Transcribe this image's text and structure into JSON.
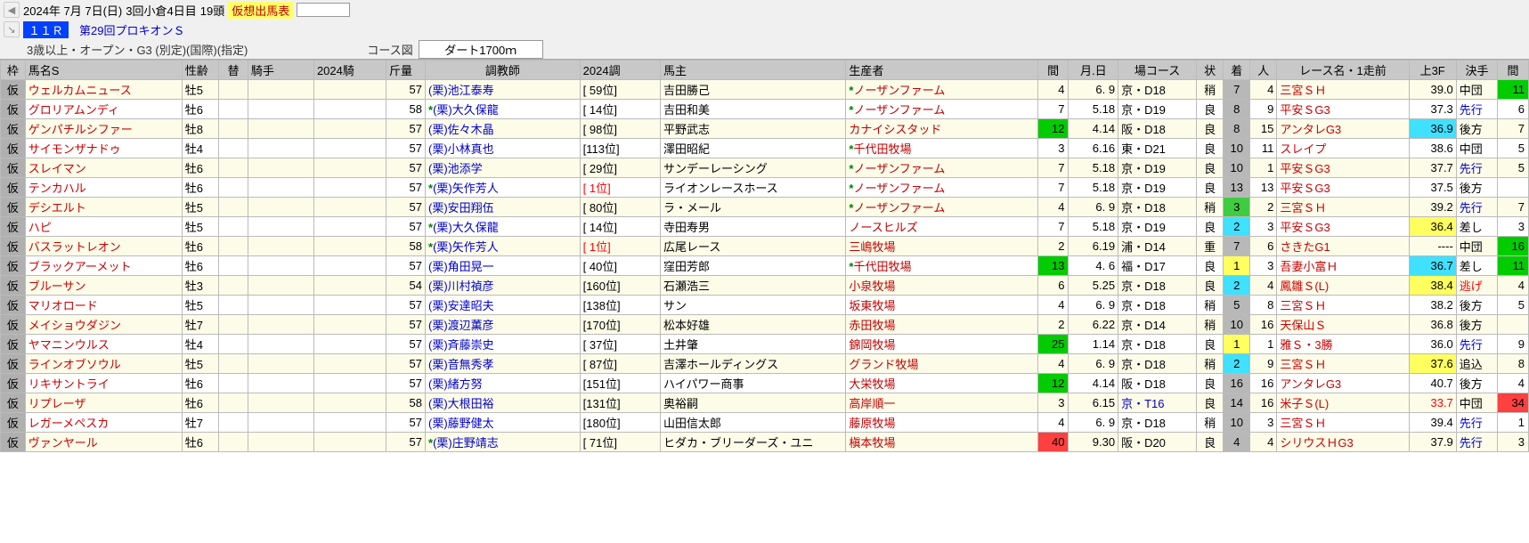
{
  "header": {
    "date": "2024年 7月 7日(日)",
    "meeting": "3回小倉4日目",
    "heads": "19頭",
    "virtual_label": "仮想出馬表",
    "race_number": "１１Ｒ",
    "race_name": "第29回プロキオンＳ",
    "race_conditions": "3歳以上・オープン・G3 (別定)(国際)(指定)",
    "course_label": "コース図",
    "course": "ダート1700ｍ"
  },
  "columns": {
    "frame": "枠",
    "name": "馬名S",
    "sex": "性齢",
    "change": "替",
    "jockey": "騎手",
    "jride": "2024騎",
    "wt": "斤量",
    "trainer": "調教師",
    "trank": "2024調",
    "owner": "馬主",
    "breeder": "生産者",
    "gap": "間",
    "md": "月.日",
    "track": "場コース",
    "cond": "状",
    "pos": "着",
    "heads": "人",
    "lrace": "レース名・1走前",
    "f3": "上3F",
    "style": "決手",
    "gap2": "間"
  },
  "rows": [
    {
      "kari": "仮",
      "name": "ウェルカムニュース",
      "sex": "牡5",
      "wt": "57",
      "trStar": "",
      "trainer": "(栗)池江泰寿",
      "trank": "[ 59位]",
      "owner": "吉田勝己",
      "brStar": "*",
      "breeder": "ノーザンファーム",
      "gap": "4",
      "md": "6. 9",
      "crs": "京・D18",
      "cond": "稍",
      "pos": "7",
      "posCls": "pos-gray",
      "heads": "4",
      "lrace": "三宮ＳＨ",
      "f3": "39.0",
      "f3Cls": "f3-norm",
      "style": "中団",
      "styleCls": "",
      "gap2": "11",
      "gap2Cls": "gap-green"
    },
    {
      "kari": "仮",
      "name": "グロリアムンディ",
      "sex": "牡6",
      "wt": "58",
      "trStar": "*",
      "trainer": "(栗)大久保龍",
      "trank": "[ 14位]",
      "owner": "吉田和美",
      "brStar": "*",
      "breeder": "ノーザンファーム",
      "gap": "7",
      "md": "5.18",
      "crs": "京・D19",
      "cond": "良",
      "pos": "8",
      "posCls": "pos-gray",
      "heads": "9",
      "lrace": "平安ＳG3",
      "f3": "37.3",
      "f3Cls": "f3-norm",
      "style": "先行",
      "styleCls": "style-blue",
      "gap2": "6",
      "gap2Cls": "gap-norm"
    },
    {
      "kari": "仮",
      "name": "ゲンパチルシファー",
      "sex": "牡8",
      "wt": "57",
      "trStar": "",
      "trainer": "(栗)佐々木晶",
      "trank": "[ 98位]",
      "owner": "平野武志",
      "brStar": "",
      "breeder": "カナイシスタッド",
      "gap": "12",
      "gapCls": "gap-green",
      "md": "4.14",
      "crs": "阪・D18",
      "cond": "良",
      "pos": "8",
      "posCls": "pos-gray",
      "heads": "15",
      "lrace": "アンタレG3",
      "f3": "36.9",
      "f3Cls": "f3-cyan",
      "style": "後方",
      "styleCls": "",
      "gap2": "7",
      "gap2Cls": "gap-norm"
    },
    {
      "kari": "仮",
      "name": "サイモンザナドゥ",
      "sex": "牡4",
      "wt": "57",
      "trStar": "",
      "trainer": "(栗)小林真也",
      "trank": "[113位]",
      "owner": "澤田昭紀",
      "brStar": "*",
      "breeder": "千代田牧場",
      "gap": "3",
      "md": "6.16",
      "crs": "東・D21",
      "cond": "良",
      "pos": "10",
      "posCls": "pos-gray",
      "heads": "11",
      "lrace": "スレイプ",
      "f3": "38.6",
      "f3Cls": "f3-norm",
      "style": "中団",
      "styleCls": "",
      "gap2": "5",
      "gap2Cls": "gap-norm"
    },
    {
      "kari": "仮",
      "name": "スレイマン",
      "sex": "牡6",
      "wt": "57",
      "trStar": "",
      "trainer": "(栗)池添学",
      "trank": "[ 29位]",
      "owner": "サンデーレーシング",
      "brStar": "*",
      "breeder": "ノーザンファーム",
      "gap": "7",
      "md": "5.18",
      "crs": "京・D19",
      "cond": "良",
      "pos": "10",
      "posCls": "pos-gray",
      "heads": "1",
      "lrace": "平安ＳG3",
      "f3": "37.7",
      "f3Cls": "f3-norm",
      "style": "先行",
      "styleCls": "style-blue",
      "gap2": "5",
      "gap2Cls": "gap-norm"
    },
    {
      "kari": "仮",
      "name": "テンカハル",
      "sex": "牡6",
      "wt": "57",
      "trStar": "*",
      "trainer": "(栗)矢作芳人",
      "trank": "[   1位]",
      "trankRed": true,
      "owner": "ライオンレースホース",
      "brStar": "*",
      "breeder": "ノーザンファーム",
      "gap": "7",
      "md": "5.18",
      "crs": "京・D19",
      "cond": "良",
      "pos": "13",
      "posCls": "pos-gray",
      "heads": "13",
      "lrace": "平安ＳG3",
      "f3": "37.5",
      "f3Cls": "f3-norm",
      "style": "後方",
      "styleCls": "",
      "gap2": "",
      "gap2Cls": "gap-norm"
    },
    {
      "kari": "仮",
      "name": "デシエルト",
      "sex": "牡5",
      "wt": "57",
      "trStar": "",
      "trainer": "(栗)安田翔伍",
      "trank": "[ 80位]",
      "owner": "ラ・メール",
      "brStar": "*",
      "breeder": "ノーザンファーム",
      "gap": "4",
      "md": "6. 9",
      "crs": "京・D18",
      "cond": "稍",
      "pos": "3",
      "posCls": "pos-green",
      "heads": "2",
      "lrace": "三宮ＳＨ",
      "f3": "39.2",
      "f3Cls": "f3-norm",
      "style": "先行",
      "styleCls": "style-blue",
      "gap2": "7",
      "gap2Cls": "gap-norm"
    },
    {
      "kari": "仮",
      "name": "ハピ",
      "sex": "牡5",
      "wt": "57",
      "trStar": "*",
      "trainer": "(栗)大久保龍",
      "trank": "[ 14位]",
      "owner": "寺田寿男",
      "brStar": "",
      "breeder": "ノースヒルズ",
      "gap": "7",
      "md": "5.18",
      "crs": "京・D19",
      "cond": "良",
      "pos": "2",
      "posCls": "pos-cyan",
      "heads": "3",
      "lrace": "平安ＳG3",
      "f3": "36.4",
      "f3Cls": "f3-yellow",
      "style": "差し",
      "styleCls": "",
      "gap2": "3",
      "gap2Cls": "gap-norm"
    },
    {
      "kari": "仮",
      "name": "バスラットレオン",
      "sex": "牡6",
      "wt": "58",
      "trStar": "*",
      "trainer": "(栗)矢作芳人",
      "trank": "[   1位]",
      "trankRed": true,
      "owner": "広尾レース",
      "brStar": "",
      "breeder": "三嶋牧場",
      "gap": "2",
      "md": "6.19",
      "crs": "浦・D14",
      "cond": "重",
      "pos": "7",
      "posCls": "pos-gray",
      "heads": "6",
      "lrace": "さきたG1",
      "f3": "----",
      "f3Cls": "f3-norm",
      "style": "中団",
      "styleCls": "",
      "gap2": "16",
      "gap2Cls": "gap-green"
    },
    {
      "kari": "仮",
      "name": "ブラックアーメット",
      "sex": "牡6",
      "wt": "57",
      "trStar": "",
      "trainer": "(栗)角田晃一",
      "trank": "[ 40位]",
      "owner": "窪田芳郎",
      "brStar": "*",
      "breeder": "千代田牧場",
      "gap": "13",
      "gapCls": "gap-green",
      "md": "4. 6",
      "crs": "福・D17",
      "cond": "良",
      "pos": "1",
      "posCls": "pos-yellow",
      "heads": "3",
      "lrace": "吾妻小富Ｈ",
      "f3": "36.7",
      "f3Cls": "f3-cyan",
      "style": "差し",
      "styleCls": "",
      "gap2": "11",
      "gap2Cls": "gap-green"
    },
    {
      "kari": "仮",
      "name": "ブルーサン",
      "sex": "牡3",
      "wt": "54",
      "trStar": "",
      "trainer": "(栗)川村禎彦",
      "trank": "[160位]",
      "owner": "石瀬浩三",
      "brStar": "",
      "breeder": "小泉牧場",
      "gap": "6",
      "md": "5.25",
      "crs": "京・D18",
      "cond": "良",
      "pos": "2",
      "posCls": "pos-cyan",
      "heads": "4",
      "lrace": "鳳雛Ｓ(L)",
      "f3": "38.4",
      "f3Cls": "f3-yellow",
      "style": "逃げ",
      "styleCls": "style-red",
      "gap2": "4",
      "gap2Cls": "gap-norm"
    },
    {
      "kari": "仮",
      "name": "マリオロード",
      "sex": "牡5",
      "wt": "57",
      "trStar": "",
      "trainer": "(栗)安達昭夫",
      "trank": "[138位]",
      "owner": "サン",
      "brStar": "",
      "breeder": "坂東牧場",
      "gap": "4",
      "md": "6. 9",
      "crs": "京・D18",
      "cond": "稍",
      "pos": "5",
      "posCls": "pos-gray",
      "heads": "8",
      "lrace": "三宮ＳＨ",
      "f3": "38.2",
      "f3Cls": "f3-norm",
      "style": "後方",
      "styleCls": "",
      "gap2": "5",
      "gap2Cls": "gap-norm"
    },
    {
      "kari": "仮",
      "name": "メイショウダジン",
      "sex": "牡7",
      "wt": "57",
      "trStar": "",
      "trainer": "(栗)渡辺薫彦",
      "trank": "[170位]",
      "owner": "松本好雄",
      "brStar": "",
      "breeder": "赤田牧場",
      "gap": "2",
      "md": "6.22",
      "crs": "京・D14",
      "cond": "稍",
      "pos": "10",
      "posCls": "pos-gray",
      "heads": "16",
      "lrace": "天保山Ｓ",
      "f3": "36.8",
      "f3Cls": "f3-norm",
      "style": "後方",
      "styleCls": "",
      "gap2": "",
      "gap2Cls": "gap-norm"
    },
    {
      "kari": "仮",
      "name": "ヤマニンウルス",
      "sex": "牡4",
      "wt": "57",
      "trStar": "",
      "trainer": "(栗)斉藤崇史",
      "trank": "[ 37位]",
      "owner": "土井肇",
      "brStar": "",
      "breeder": "錦岡牧場",
      "gap": "25",
      "gapCls": "gap-green",
      "md": "1.14",
      "crs": "京・D18",
      "cond": "良",
      "pos": "1",
      "posCls": "pos-yellow",
      "heads": "1",
      "lrace": "雅Ｓ・3勝",
      "f3": "36.0",
      "f3Cls": "f3-norm",
      "style": "先行",
      "styleCls": "style-blue",
      "gap2": "9",
      "gap2Cls": "gap-norm"
    },
    {
      "kari": "仮",
      "name": "ラインオブソウル",
      "sex": "牡5",
      "wt": "57",
      "trStar": "",
      "trainer": "(栗)音無秀孝",
      "trank": "[ 87位]",
      "owner": "吉澤ホールディングス",
      "brStar": "",
      "breeder": "グランド牧場",
      "gap": "4",
      "md": "6. 9",
      "crs": "京・D18",
      "cond": "稍",
      "pos": "2",
      "posCls": "pos-cyan",
      "heads": "9",
      "lrace": "三宮ＳＨ",
      "f3": "37.6",
      "f3Cls": "f3-yellow",
      "style": "追込",
      "styleCls": "",
      "gap2": "8",
      "gap2Cls": "gap-norm"
    },
    {
      "kari": "仮",
      "name": "リキサントライ",
      "sex": "牡6",
      "wt": "57",
      "trStar": "",
      "trainer": "(栗)緒方努",
      "trank": "[151位]",
      "owner": "ハイパワー商事",
      "brStar": "",
      "breeder": "大栄牧場",
      "gap": "12",
      "gapCls": "gap-green",
      "md": "4.14",
      "crs": "阪・D18",
      "cond": "良",
      "pos": "16",
      "posCls": "pos-gray",
      "heads": "16",
      "lrace": "アンタレG3",
      "f3": "40.7",
      "f3Cls": "f3-norm",
      "style": "後方",
      "styleCls": "",
      "gap2": "4",
      "gap2Cls": "gap-norm"
    },
    {
      "kari": "仮",
      "name": "リプレーザ",
      "sex": "牡6",
      "wt": "58",
      "trStar": "",
      "trainer": "(栗)大根田裕",
      "trank": "[131位]",
      "owner": "奥裕嗣",
      "brStar": "",
      "breeder": "高岸順一",
      "gap": "3",
      "md": "6.15",
      "crs": "京・T16",
      "crsBlue": true,
      "cond": "良",
      "pos": "14",
      "posCls": "pos-gray",
      "heads": "16",
      "lrace": "米子Ｓ(L)",
      "f3": "33.7",
      "f3Cls": "f3-red",
      "style": "中団",
      "styleCls": "",
      "gap2": "34",
      "gap2Cls": "gap-red"
    },
    {
      "kari": "仮",
      "name": "レガーメペスカ",
      "sex": "牡7",
      "wt": "57",
      "trStar": "",
      "trainer": "(栗)藤野健太",
      "trank": "[180位]",
      "owner": "山田信太郎",
      "brStar": "",
      "breeder": "藤原牧場",
      "gap": "4",
      "md": "6. 9",
      "crs": "京・D18",
      "cond": "稍",
      "pos": "10",
      "posCls": "pos-gray",
      "heads": "3",
      "lrace": "三宮ＳＨ",
      "f3": "39.4",
      "f3Cls": "f3-norm",
      "style": "先行",
      "styleCls": "style-blue",
      "gap2": "1",
      "gap2Cls": "gap-norm"
    },
    {
      "kari": "仮",
      "name": "ヴァンヤール",
      "sex": "牡6",
      "wt": "57",
      "trStar": "*",
      "trainer": "(栗)庄野靖志",
      "trank": "[ 71位]",
      "owner": "ヒダカ・ブリーダーズ・ユニ",
      "brStar": "",
      "breeder": "槇本牧場",
      "gap": "40",
      "gapCls": "gap-red",
      "md": "9.30",
      "crs": "阪・D20",
      "cond": "良",
      "pos": "4",
      "posCls": "pos-gray",
      "heads": "4",
      "lrace": "シリウスＨG3",
      "f3": "37.9",
      "f3Cls": "f3-norm",
      "style": "先行",
      "styleCls": "style-blue",
      "gap2": "3",
      "gap2Cls": "gap-norm"
    }
  ]
}
